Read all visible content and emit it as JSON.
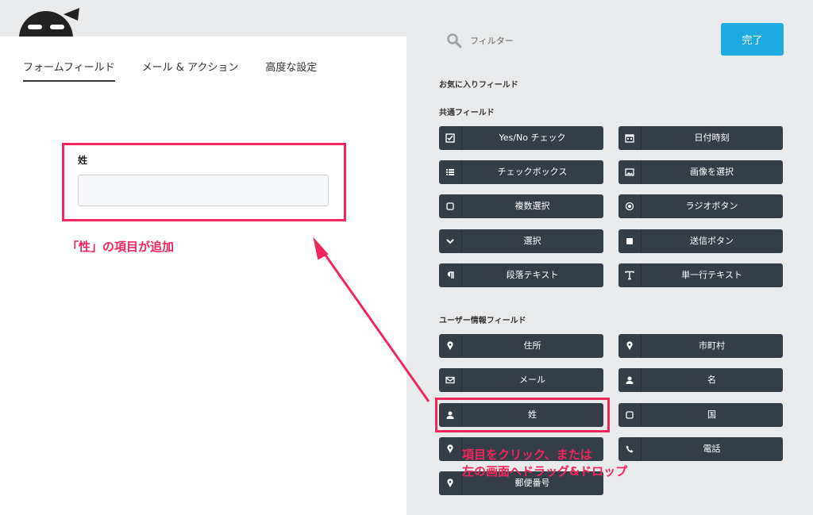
{
  "header": {
    "tabs": [
      {
        "label": "フォームフィールド",
        "active": true
      },
      {
        "label": "メール & アクション",
        "active": false
      },
      {
        "label": "高度な設定",
        "active": false
      }
    ]
  },
  "form": {
    "field_label": "姓",
    "field_value": ""
  },
  "annotations": {
    "added": "「性」の項目が追加",
    "instruction_line1": "項目をクリック、または",
    "instruction_line2": "左の画面へドラッグ&ドロップ"
  },
  "sidebar": {
    "search_placeholder": "フィルター",
    "done_label": "完了",
    "favorites_title": "お気に入りフィールド",
    "common_title": "共通フィールド",
    "common_fields": [
      {
        "label": "Yes/No チェック",
        "icon": "checkbox-icon"
      },
      {
        "label": "日付時刻",
        "icon": "calendar-icon"
      },
      {
        "label": "チェックボックス",
        "icon": "list-icon"
      },
      {
        "label": "画像を選択",
        "icon": "image-icon"
      },
      {
        "label": "複数選択",
        "icon": "square-outline-icon"
      },
      {
        "label": "ラジオボタン",
        "icon": "radio-icon"
      },
      {
        "label": "選択",
        "icon": "chevron-down-icon"
      },
      {
        "label": "送信ボタン",
        "icon": "square-filled-icon"
      },
      {
        "label": "段落テキスト",
        "icon": "paragraph-icon"
      },
      {
        "label": "単一行テキスト",
        "icon": "text-icon"
      }
    ],
    "user_title": "ユーザー情報フィールド",
    "user_fields": [
      {
        "label": "住所",
        "icon": "map-marker-icon"
      },
      {
        "label": "市町村",
        "icon": "map-marker-icon"
      },
      {
        "label": "メール",
        "icon": "envelope-icon"
      },
      {
        "label": "名",
        "icon": "user-icon"
      },
      {
        "label": "姓",
        "icon": "user-icon"
      },
      {
        "label": "国",
        "icon": "square-outline-icon"
      },
      {
        "label": "",
        "icon": "map-marker-icon"
      },
      {
        "label": "電話",
        "icon": "phone-icon"
      },
      {
        "label": "郵便番号",
        "icon": "map-marker-icon"
      }
    ]
  },
  "colors": {
    "accent": "#f0265c",
    "button_bg": "#353e47",
    "done_bg": "#1ea9e1"
  }
}
